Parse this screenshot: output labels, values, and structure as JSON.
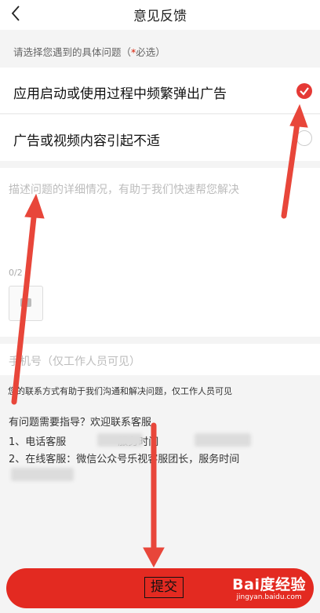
{
  "header": {
    "title": "意见反馈"
  },
  "section_label": {
    "text": "请选择您遇到的具体问题（",
    "star": "*",
    "required": "必选）"
  },
  "options": [
    {
      "label": "应用启动或使用过程中频繁弹出广告",
      "selected": true
    },
    {
      "label": "广告或视频内容引起不适",
      "selected": false
    }
  ],
  "description": {
    "placeholder": "描述问题的详细情况，有助于我们快速帮您解决",
    "counter": "0/2"
  },
  "phone": {
    "placeholder": "手机号（仅工作人员可见）",
    "note": "您的联系方式有助于我们沟通和解决问题，仅工作人员可见"
  },
  "help": {
    "heading": "有问题需要指导？欢迎联系客服。",
    "line1_prefix": "1、电话客服",
    "line1_mid": "服务时间",
    "line2": "2、在线客服：微信公众号乐视客服团长，服务时间"
  },
  "submit": {
    "label": "提交"
  },
  "watermark": {
    "brand": "Bai度经验",
    "url": "jingyan.baidu.com"
  },
  "colors": {
    "accent": "#e32a21",
    "check": "#e53935",
    "arrow": "#e8463a"
  }
}
